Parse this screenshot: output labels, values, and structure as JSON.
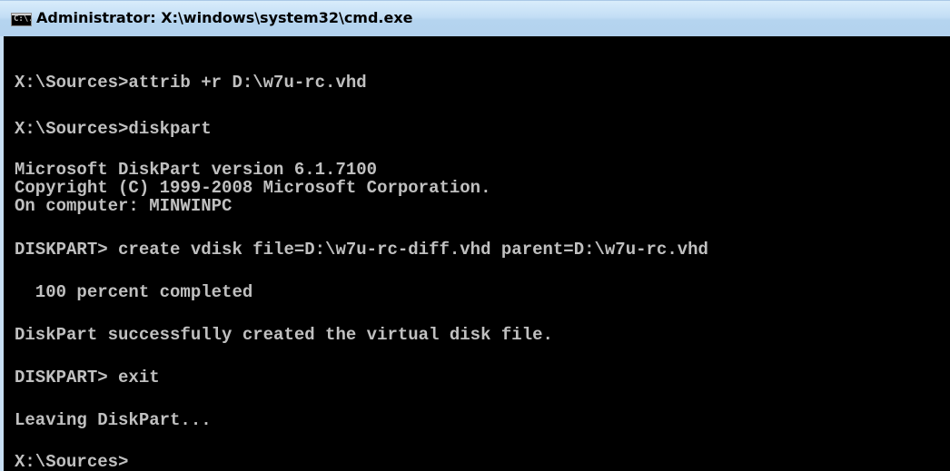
{
  "window": {
    "title": "Administrator: X:\\windows\\system32\\cmd.exe",
    "icon_text": "C:\\."
  },
  "console": {
    "lines": [
      "X:\\Sources>attrib +r D:\\w7u-rc.vhd",
      "X:\\Sources>diskpart",
      "Microsoft DiskPart version 6.1.7100",
      "Copyright (C) 1999-2008 Microsoft Corporation.",
      "On computer: MINWINPC",
      "DISKPART> create vdisk file=D:\\w7u-rc-diff.vhd parent=D:\\w7u-rc.vhd",
      "  100 percent completed",
      "DiskPart successfully created the virtual disk file.",
      "DISKPART> exit",
      "Leaving DiskPart...",
      "X:\\Sources>"
    ]
  }
}
